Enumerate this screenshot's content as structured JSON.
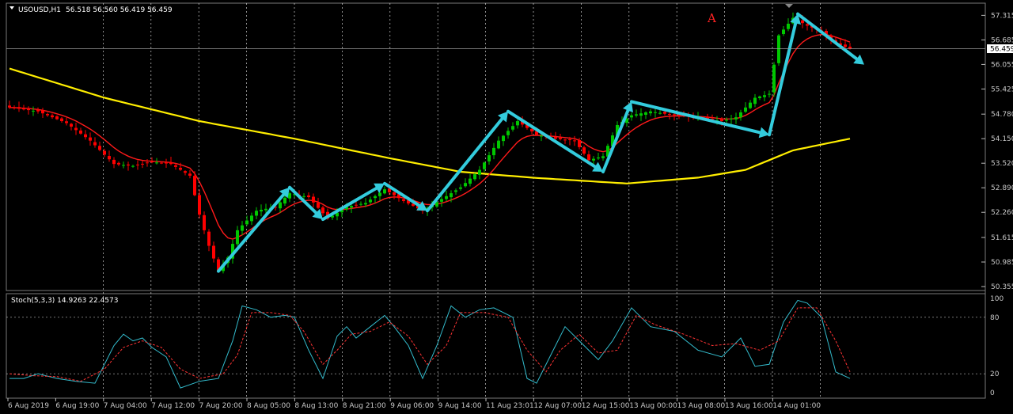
{
  "header": {
    "dropdown_icon": "triangle-down-icon",
    "symbol_title": "USOUSD,H1",
    "ohlc": "56.518 56.560 56.419 56.459"
  },
  "colors": {
    "background": "#000000",
    "bull_candle": "#00c800",
    "bear_candle": "#ff0000",
    "fast_ma": "#ff1a1a",
    "slow_ma": "#ffee00",
    "arrows": "#33ccdd",
    "stoch_main": "#33bbcc",
    "stoch_signal": "#ff3333",
    "grid": "#ffffff",
    "annotation": "#ff2222"
  },
  "chart_data": [
    {
      "type": "candlestick",
      "symbol": "USOUSD",
      "timeframe": "H1",
      "y_ticks": [
        "57.315",
        "56.685",
        "56.055",
        "55.425",
        "54.780",
        "54.150",
        "53.520",
        "52.890",
        "52.260",
        "51.615",
        "50.985",
        "50.355"
      ],
      "ylim": [
        50.355,
        57.465
      ],
      "grid": "dotted",
      "current_price_label": "56.459",
      "annotation_label": "A",
      "x_ticks": [
        "6 Aug 2019",
        "6 Aug 19:00",
        "7 Aug 04:00",
        "7 Aug 12:00",
        "7 Aug 20:00",
        "8 Aug 05:00",
        "8 Aug 13:00",
        "8 Aug 21:00",
        "9 Aug 06:00",
        "9 Aug 14:00",
        "11 Aug 23:01",
        "12 Aug 07:00",
        "12 Aug 15:00",
        "13 Aug 00:00",
        "13 Aug 08:00",
        "13 Aug 16:00",
        "14 Aug 01:00"
      ],
      "moving_averages": [
        "fast (red)",
        "slow (yellow)"
      ],
      "price_path": [
        [
          0,
          54.95
        ],
        [
          6,
          54.85
        ],
        [
          12,
          54.55
        ],
        [
          17,
          54.1
        ],
        [
          22,
          53.5
        ],
        [
          26,
          53.45
        ],
        [
          30,
          53.55
        ],
        [
          34,
          53.5
        ],
        [
          38,
          53.2
        ],
        [
          40,
          52.2
        ],
        [
          42,
          51.4
        ],
        [
          44,
          50.75
        ],
        [
          46,
          51.1
        ],
        [
          48,
          51.8
        ],
        [
          52,
          52.3
        ],
        [
          56,
          52.4
        ],
        [
          59,
          52.75
        ],
        [
          63,
          52.65
        ],
        [
          67,
          52.1
        ],
        [
          71,
          52.4
        ],
        [
          75,
          52.5
        ],
        [
          79,
          52.85
        ],
        [
          83,
          52.55
        ],
        [
          87,
          52.3
        ],
        [
          91,
          52.6
        ],
        [
          95,
          52.9
        ],
        [
          99,
          53.35
        ],
        [
          103,
          54.1
        ],
        [
          107,
          54.6
        ],
        [
          111,
          54.25
        ],
        [
          115,
          54.15
        ],
        [
          119,
          54.1
        ],
        [
          122,
          53.6
        ],
        [
          125,
          53.7
        ],
        [
          128,
          54.5
        ],
        [
          131,
          54.75
        ],
        [
          135,
          54.85
        ],
        [
          140,
          54.75
        ],
        [
          145,
          54.7
        ],
        [
          150,
          54.6
        ],
        [
          153,
          54.7
        ],
        [
          157,
          55.2
        ],
        [
          160,
          55.3
        ],
        [
          162,
          56.8
        ],
        [
          165,
          57.25
        ],
        [
          168,
          57.05
        ],
        [
          171,
          56.9
        ],
        [
          174,
          56.6
        ],
        [
          177,
          56.459
        ]
      ],
      "zigzag_arrows": [
        [
          [
            44,
            50.75
          ],
          [
            59,
            52.9
          ]
        ],
        [
          [
            59,
            52.9
          ],
          [
            66,
            52.08
          ]
        ],
        [
          [
            66,
            52.08
          ],
          [
            79,
            53.0
          ]
        ],
        [
          [
            79,
            53.0
          ],
          [
            88,
            52.3
          ]
        ],
        [
          [
            88,
            52.3
          ],
          [
            105,
            54.85
          ]
        ],
        [
          [
            105,
            54.85
          ],
          [
            125,
            53.3
          ]
        ],
        [
          [
            125,
            53.3
          ],
          [
            131,
            55.1
          ]
        ],
        [
          [
            131,
            55.1
          ],
          [
            160,
            54.25
          ]
        ],
        [
          [
            160,
            54.25
          ],
          [
            166,
            57.35
          ]
        ],
        [
          [
            166,
            57.35
          ],
          [
            180,
            56.05
          ]
        ]
      ]
    },
    {
      "type": "line",
      "indicator_label": "Stoch(5,3,3) 14.9263 22.4573",
      "y_ticks": [
        "100",
        "80",
        "20",
        "0"
      ],
      "levels": [
        80,
        20
      ],
      "ylim": [
        0,
        100
      ],
      "series": [
        {
          "values": [
            [
              0,
              15
            ],
            [
              3,
              15
            ],
            [
              6,
              20
            ],
            [
              10,
              15
            ],
            [
              14,
              12
            ],
            [
              18,
              10
            ],
            [
              22,
              50
            ],
            [
              24,
              62
            ],
            [
              26,
              55
            ],
            [
              28,
              58
            ],
            [
              30,
              48
            ],
            [
              33,
              38
            ],
            [
              36,
              5
            ],
            [
              40,
              12
            ],
            [
              44,
              15
            ],
            [
              47,
              55
            ],
            [
              49,
              92
            ],
            [
              52,
              88
            ],
            [
              55,
              80
            ],
            [
              58,
              82
            ],
            [
              60,
              80
            ],
            [
              63,
              45
            ],
            [
              66,
              15
            ],
            [
              69,
              60
            ],
            [
              71,
              70
            ],
            [
              73,
              58
            ],
            [
              76,
              70
            ],
            [
              79,
              82
            ],
            [
              81,
              70
            ],
            [
              84,
              50
            ],
            [
              87,
              15
            ],
            [
              90,
              50
            ],
            [
              93,
              92
            ],
            [
              96,
              80
            ],
            [
              99,
              88
            ],
            [
              102,
              90
            ],
            [
              106,
              80
            ],
            [
              109,
              15
            ],
            [
              111,
              10
            ],
            [
              114,
              40
            ],
            [
              117,
              70
            ],
            [
              120,
              55
            ],
            [
              124,
              35
            ],
            [
              127,
              55
            ],
            [
              131,
              90
            ],
            [
              135,
              70
            ],
            [
              140,
              65
            ],
            [
              145,
              45
            ],
            [
              150,
              38
            ],
            [
              154,
              58
            ],
            [
              157,
              28
            ],
            [
              160,
              30
            ],
            [
              163,
              75
            ],
            [
              166,
              98
            ],
            [
              168,
              95
            ],
            [
              171,
              80
            ],
            [
              174,
              22
            ],
            [
              177,
              15
            ]
          ]
        },
        {
          "values": [
            [
              0,
              20
            ],
            [
              5,
              18
            ],
            [
              10,
              17
            ],
            [
              15,
              12
            ],
            [
              20,
              25
            ],
            [
              24,
              48
            ],
            [
              28,
              55
            ],
            [
              32,
              48
            ],
            [
              36,
              25
            ],
            [
              40,
              15
            ],
            [
              45,
              20
            ],
            [
              48,
              40
            ],
            [
              51,
              85
            ],
            [
              55,
              85
            ],
            [
              59,
              82
            ],
            [
              62,
              65
            ],
            [
              66,
              30
            ],
            [
              69,
              45
            ],
            [
              72,
              62
            ],
            [
              76,
              65
            ],
            [
              80,
              75
            ],
            [
              84,
              60
            ],
            [
              88,
              30
            ],
            [
              92,
              50
            ],
            [
              95,
              85
            ],
            [
              100,
              85
            ],
            [
              105,
              80
            ],
            [
              109,
              45
            ],
            [
              113,
              22
            ],
            [
              116,
              45
            ],
            [
              120,
              62
            ],
            [
              124,
              42
            ],
            [
              128,
              45
            ],
            [
              132,
              82
            ],
            [
              136,
              72
            ],
            [
              142,
              62
            ],
            [
              148,
              50
            ],
            [
              153,
              52
            ],
            [
              158,
              45
            ],
            [
              162,
              55
            ],
            [
              166,
              90
            ],
            [
              170,
              90
            ],
            [
              174,
              55
            ],
            [
              177,
              22
            ]
          ]
        }
      ]
    }
  ]
}
